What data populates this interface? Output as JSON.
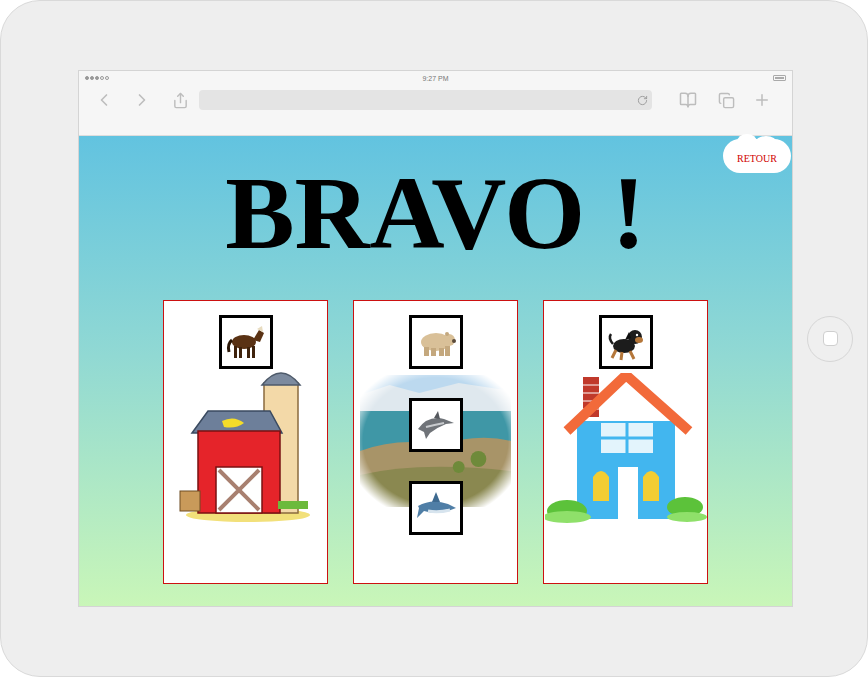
{
  "status_bar": {
    "time": "9:27 PM"
  },
  "page": {
    "heading": "BRAVO !",
    "back_button": "RETOUR"
  },
  "cards": [
    {
      "kind": "farm",
      "animals": [
        {
          "kind": "horse"
        }
      ]
    },
    {
      "kind": "nature",
      "animals": [
        {
          "kind": "bear"
        },
        {
          "kind": "dolphin"
        },
        {
          "kind": "shark"
        }
      ]
    },
    {
      "kind": "house",
      "animals": [
        {
          "kind": "dog"
        }
      ]
    }
  ]
}
